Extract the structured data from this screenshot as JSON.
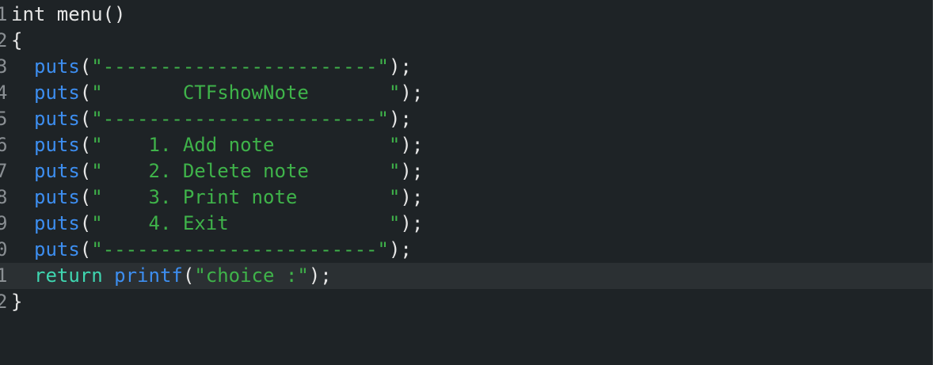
{
  "editor": {
    "line_numbers": [
      "1",
      "2",
      "3",
      "4",
      "5",
      "6",
      "7",
      "8",
      "9",
      "0",
      "1",
      "2"
    ],
    "current_line": 11,
    "colors": {
      "background": "#1e2326",
      "current_line": "#2b3033",
      "function": "#3d8ef0",
      "keyword": "#3fd6b0",
      "string": "#3fb34a",
      "text": "#e6e6e6"
    },
    "lines": {
      "l1": "int menu()",
      "l2": "{",
      "l3_fn": "puts",
      "l3_str": "\"------------------------\"",
      "l4_fn": "puts",
      "l4_str": "\"       CTFshowNote       \"",
      "l5_fn": "puts",
      "l5_str": "\"------------------------\"",
      "l6_fn": "puts",
      "l6_str": "\"    1. Add note          \"",
      "l7_fn": "puts",
      "l7_str": "\"    2. Delete note       \"",
      "l8_fn": "puts",
      "l8_str": "\"    3. Print note        \"",
      "l9_fn": "puts",
      "l9_str": "\"    4. Exit              \"",
      "l10_fn": "puts",
      "l10_str": "\"------------------------\"",
      "l11_kw": "return",
      "l11_fn": "printf",
      "l11_str": "\"choice :\"",
      "l12": "}"
    }
  }
}
